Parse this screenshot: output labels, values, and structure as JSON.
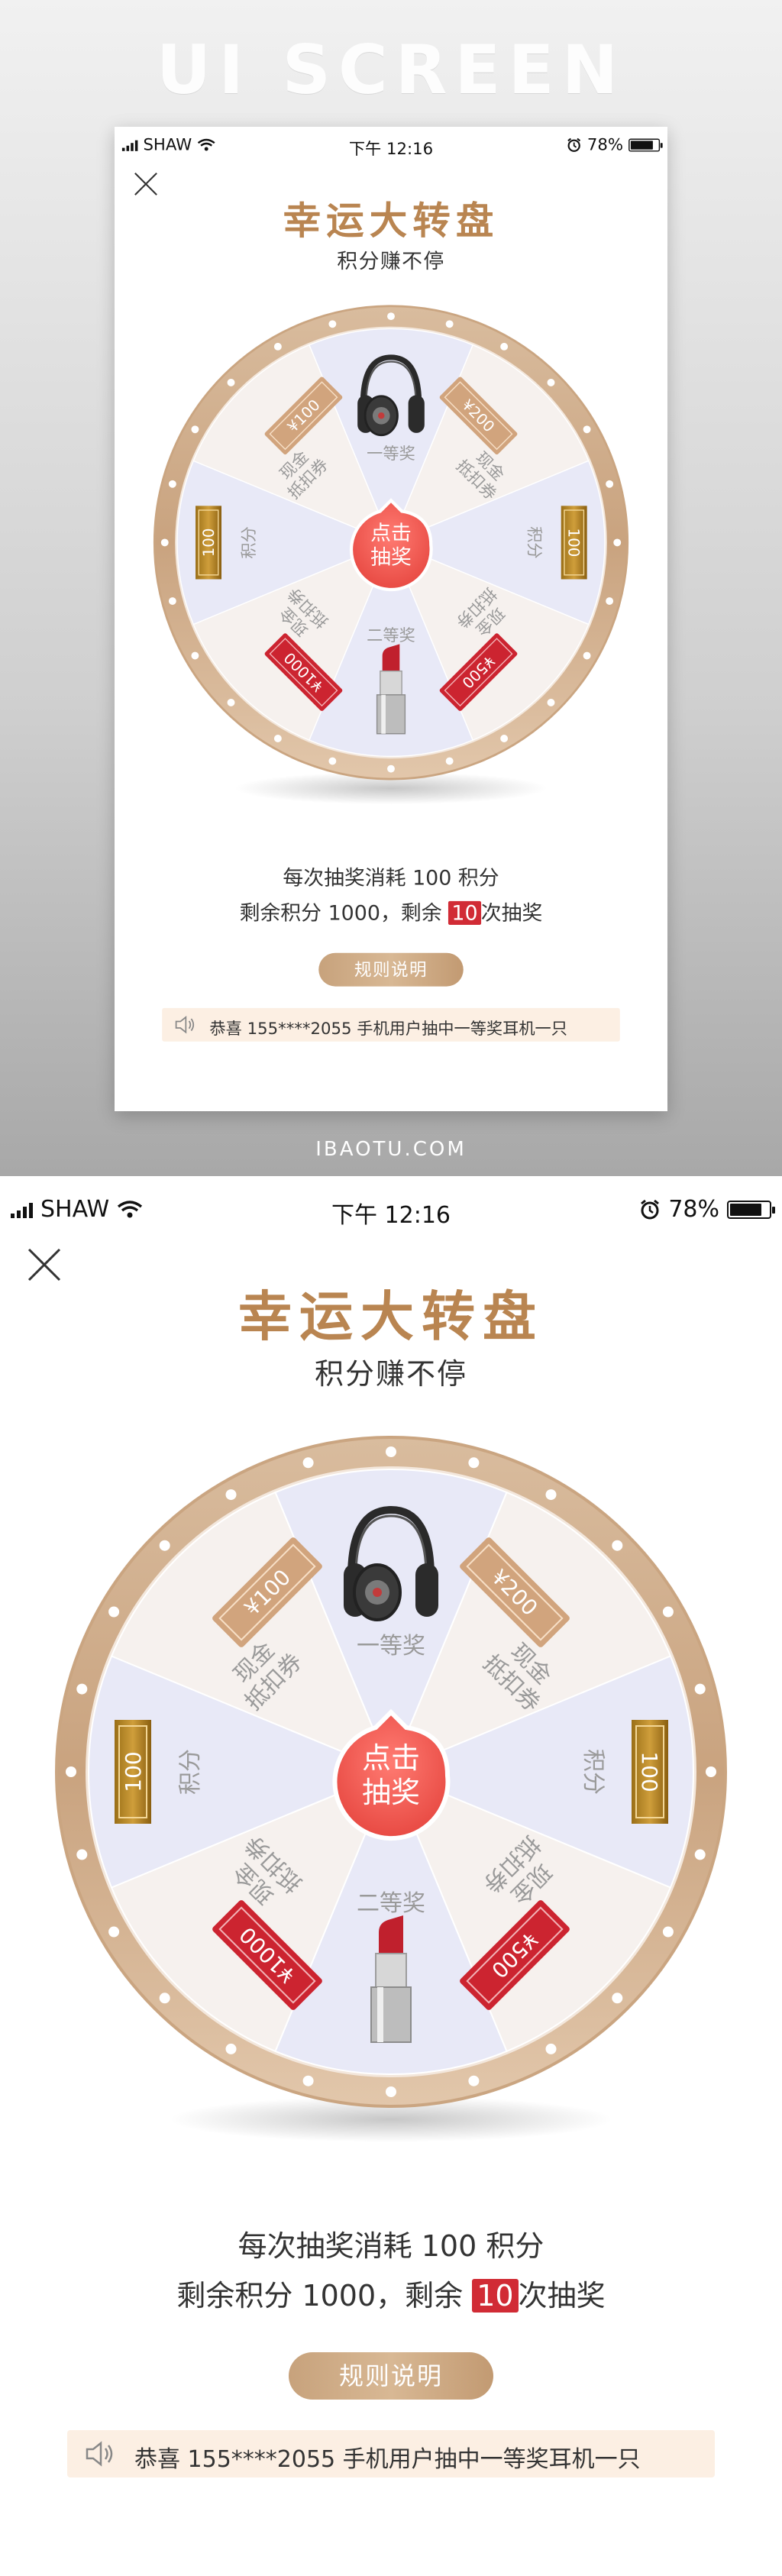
{
  "banner": {
    "title": "UI SCREEN",
    "footer": "IBAOTU.COM"
  },
  "status": {
    "carrier": "SHAW",
    "time": "下午 12:16",
    "battery": "78%"
  },
  "header": {
    "title": "幸运大转盘",
    "subtitle": "积分赚不停"
  },
  "wheel": {
    "center_label_1": "点击",
    "center_label_2": "抽奖",
    "prizes": {
      "top": "一等奖",
      "top_right_line1": "现金",
      "top_right_line2": "抵扣券",
      "top_right_ticket": "¥200",
      "right": "积分",
      "right_ticket": "100",
      "bottom_right_line1": "现金",
      "bottom_right_line2": "抵扣券",
      "bottom_right_ticket": "¥500",
      "bottom": "二等奖",
      "bottom_left_line1": "现金",
      "bottom_left_line2": "抵扣券",
      "bottom_left_ticket": "¥1000",
      "left": "积分",
      "left_ticket": "100",
      "top_left_line1": "现金",
      "top_left_line2": "抵扣券",
      "top_left_ticket": "¥100"
    }
  },
  "draw": {
    "cost_text": "每次抽奖消耗 100 积分",
    "remaining_prefix": "剩余积分 1000，剩余",
    "remaining_count": "10",
    "remaining_suffix": "次抽奖"
  },
  "rules_button": "规则说明",
  "notice": {
    "text": "恭喜 155****2055 手机用户抽中一等奖耳机一只"
  },
  "colors": {
    "accent_gold": "#b98551",
    "red": "#d12b35",
    "slice_lavender": "#e8e9f7",
    "slice_cream": "#f6f1ee"
  }
}
